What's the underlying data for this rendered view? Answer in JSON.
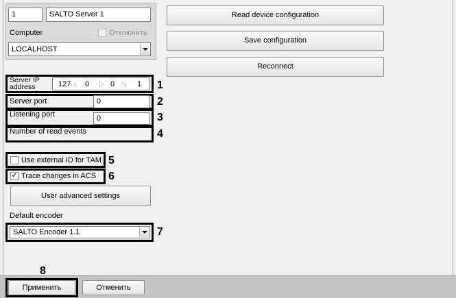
{
  "server": {
    "id": "1",
    "name": "SALTO Server 1",
    "computer_label": "Computer",
    "disable_label": "Отключить",
    "computer_value": "LOCALHOST"
  },
  "actions": {
    "read_config": "Read device configuration",
    "save_config": "Save configuration",
    "reconnect": "Reconnect"
  },
  "settings": {
    "server_ip_label": "Server IP address",
    "ip_octets": [
      "127",
      "0",
      "0",
      "1"
    ],
    "ip_dot": ".",
    "server_port_label": "Server port",
    "server_port_value": "0",
    "listening_port_label": "Listening port",
    "listening_port_value": "0",
    "read_events_label": "Number of read events",
    "external_id_label": "Use external ID for TAM",
    "external_id_checked": false,
    "trace_label": "Trace changes in ACS",
    "trace_checked": true,
    "advanced_button": "User advanced settings",
    "default_encoder_label": "Default encoder",
    "default_encoder_value": "SALTO Encoder 1.1"
  },
  "footer": {
    "apply": "Применить",
    "cancel": "Отменить"
  },
  "callouts": [
    "1",
    "2",
    "3",
    "4",
    "5",
    "6",
    "7",
    "8"
  ],
  "check_mark": "✓"
}
